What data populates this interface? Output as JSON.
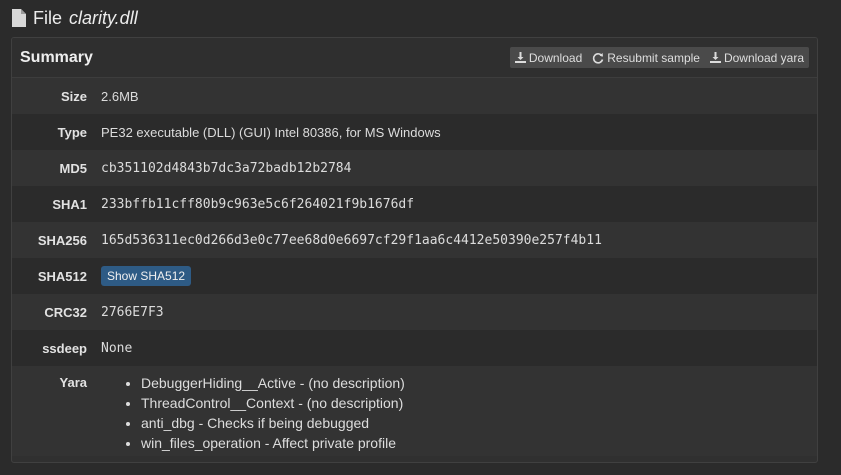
{
  "header": {
    "prefix": "File",
    "filename": "clarity.dll",
    "icon": "file-icon"
  },
  "summary": {
    "title": "Summary",
    "buttons": {
      "download": "Download",
      "resubmit": "Resubmit sample",
      "download_yara": "Download yara"
    },
    "rows": {
      "size": {
        "label": "Size",
        "value": "2.6MB"
      },
      "type": {
        "label": "Type",
        "value": "PE32 executable (DLL) (GUI) Intel 80386, for MS Windows"
      },
      "md5": {
        "label": "MD5",
        "value": "cb351102d4843b7dc3a72badb12b2784"
      },
      "sha1": {
        "label": "SHA1",
        "value": "233bffb11cff80b9c963e5c6f264021f9b1676df"
      },
      "sha256": {
        "label": "SHA256",
        "value": "165d536311ec0d266d3e0c77ee68d0e6697cf29f1aa6c4412e50390e257f4b11"
      },
      "sha512": {
        "label": "SHA512",
        "button": "Show SHA512"
      },
      "crc32": {
        "label": "CRC32",
        "value": "2766E7F3"
      },
      "ssdeep": {
        "label": "ssdeep",
        "value": "None"
      },
      "yara": {
        "label": "Yara",
        "items": [
          "DebuggerHiding__Active - (no description)",
          "ThreadControl__Context - (no description)",
          "anti_dbg - Checks if being debugged",
          "win_files_operation - Affect private profile"
        ]
      }
    }
  },
  "colors": {
    "background": "#2b2b2b",
    "panel": "#303030",
    "sha512_button": "#2e5b85"
  }
}
